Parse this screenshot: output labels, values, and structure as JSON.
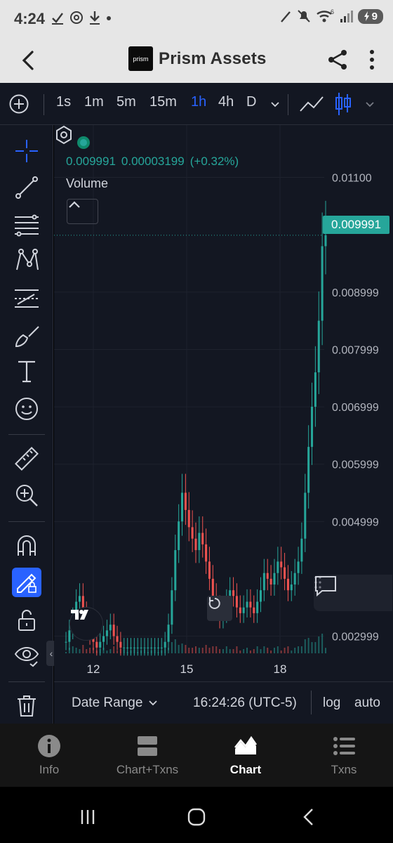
{
  "status_bar": {
    "time": "4:24",
    "battery": "9",
    "network_badge": "6"
  },
  "header": {
    "title": "Prism Assets",
    "logo_text": "prism"
  },
  "toolbar": {
    "intervals": [
      "1s",
      "1m",
      "5m",
      "15m",
      "1h",
      "4h",
      "D"
    ],
    "active_interval": "1h"
  },
  "legend": {
    "price": "0.009991",
    "change": "0.00003199",
    "change_pct": "(+0.32%)",
    "volume_label": "Volume"
  },
  "price_axis": {
    "ticks": [
      "0.01100",
      "0.008999",
      "0.007999",
      "0.006999",
      "0.005999",
      "0.004999",
      "0.002999"
    ],
    "current_price_tag": "0.009991"
  },
  "time_axis": {
    "ticks": [
      "12",
      "15",
      "18"
    ]
  },
  "chart_footer": {
    "date_range_label": "Date Range",
    "clock": "16:24:26 (UTC-5)",
    "log_label": "log",
    "auto_label": "auto"
  },
  "tabs": [
    {
      "label": "Info",
      "icon": "info-icon"
    },
    {
      "label": "Chart+Txns",
      "icon": "split-view-icon"
    },
    {
      "label": "Chart",
      "icon": "chart-icon"
    },
    {
      "label": "Txns",
      "icon": "list-icon"
    }
  ],
  "active_tab": "Chart",
  "colors": {
    "up": "#26a69a",
    "down": "#ef5350",
    "accent": "#2962ff",
    "background": "#131722"
  },
  "chart_data": {
    "type": "candlestick",
    "title": "",
    "x_ticks": [
      "12",
      "15",
      "18"
    ],
    "y_ticks": [
      0.002999,
      0.004999,
      0.005999,
      0.006999,
      0.007999,
      0.008999,
      0.011
    ],
    "last_price": 0.009991,
    "series": [
      {
        "x": [
          0,
          4,
          8,
          12,
          16,
          20,
          24,
          28,
          32,
          36,
          40,
          44,
          48,
          52,
          56,
          60,
          64,
          68,
          72,
          76,
          80,
          84,
          88,
          92,
          96,
          100,
          104,
          108,
          112,
          116,
          120,
          124,
          128,
          132,
          136,
          140,
          144,
          148,
          152,
          156,
          160,
          164,
          168,
          172,
          176,
          180,
          184,
          188,
          192,
          196,
          200,
          204,
          208,
          212,
          216,
          220,
          224,
          228,
          232,
          236,
          240,
          244,
          248,
          252,
          256,
          260,
          264,
          268,
          272,
          276,
          280,
          284,
          288,
          292,
          296,
          300,
          304
        ],
        "close": [
          0.0029,
          0.0031,
          0.0033,
          0.0036,
          0.0037,
          0.0034,
          0.0032,
          0.003,
          0.0029,
          0.0028,
          0.0029,
          0.003,
          0.0031,
          0.0032,
          0.003,
          0.0029,
          0.0028,
          0.0028,
          0.0028,
          0.0028,
          0.0028,
          0.0028,
          0.0028,
          0.0028,
          0.0028,
          0.0028,
          0.0028,
          0.0028,
          0.0028,
          0.0029,
          0.0032,
          0.0038,
          0.0045,
          0.005,
          0.0055,
          0.0052,
          0.0049,
          0.0047,
          0.0045,
          0.0048,
          0.0046,
          0.0043,
          0.004,
          0.0037,
          0.0035,
          0.0033,
          0.0034,
          0.0036,
          0.0038,
          0.0037,
          0.0035,
          0.0034,
          0.0035,
          0.0036,
          0.0035,
          0.0034,
          0.0036,
          0.0038,
          0.0041,
          0.004,
          0.0039,
          0.0041,
          0.0043,
          0.0042,
          0.004,
          0.0038,
          0.0039,
          0.0041,
          0.0043,
          0.0047,
          0.0055,
          0.0063,
          0.007,
          0.0076,
          0.0085,
          0.0098,
          0.009991
        ]
      }
    ]
  }
}
